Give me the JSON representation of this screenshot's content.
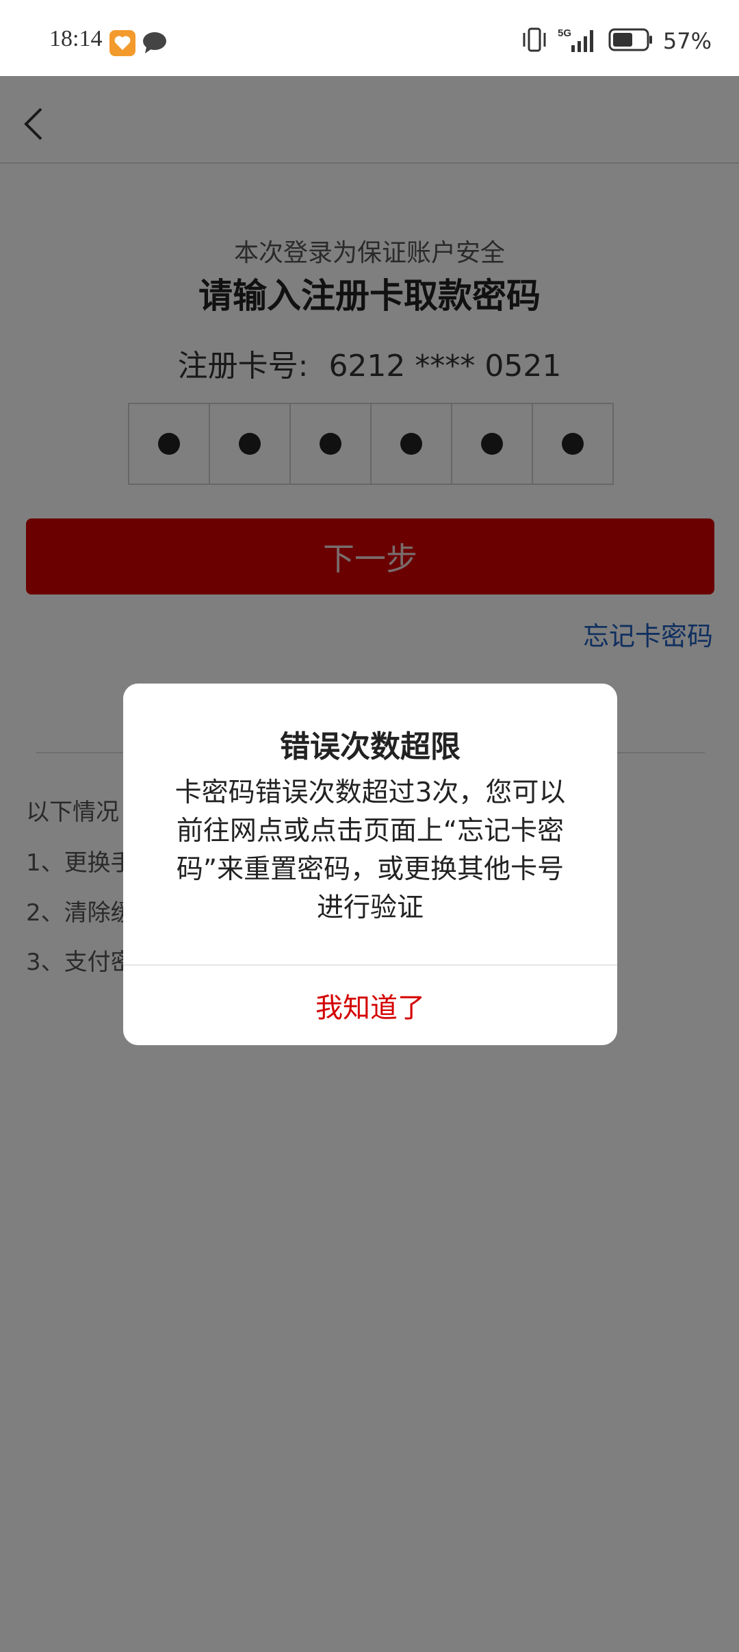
{
  "status_bar": {
    "time": "18:14",
    "network": "5G",
    "battery_text": "57%",
    "icons": [
      "health-app-icon",
      "message-bubble-icon",
      "vibrate-icon",
      "signal-5g-icon",
      "battery-icon"
    ]
  },
  "header": {
    "back_icon": "chevron-left-icon"
  },
  "login": {
    "subtitle": "本次登录为保证账户安全",
    "title": "请输入注册卡取款密码",
    "card_label": "注册卡号:",
    "card_number": "6212 **** 0521",
    "pin_filled": 6,
    "next_button": "下一步",
    "forgot_link": "忘记卡密码"
  },
  "info": {
    "title": "以下情况",
    "items": [
      "1、更换手",
      "2、清除缓",
      "3、支付密"
    ]
  },
  "dialog": {
    "title": "错误次数超限",
    "body": "卡密码错误次数超过3次，您可以前往网点或点击页面上“忘记卡密码”来重置密码，或更换其他卡号进行验证",
    "confirm_button": "我知道了"
  },
  "colors": {
    "primary_red": "#d40000",
    "link_blue": "#1f5fbf",
    "overlay": "rgba(0,0,0,0.5)"
  }
}
